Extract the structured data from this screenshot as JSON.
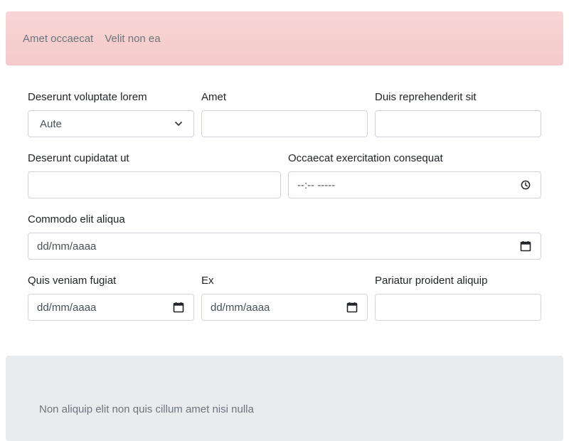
{
  "nav": {
    "links": [
      "Amet occaecat",
      "Velit non ea"
    ]
  },
  "form": {
    "row1": {
      "select": {
        "label": "Deserunt voluptate lorem",
        "value": "Aute"
      },
      "text1": {
        "label": "Amet",
        "value": ""
      },
      "text2": {
        "label": "Duis reprehenderit sit",
        "value": ""
      }
    },
    "row2": {
      "text": {
        "label": "Deserunt cupidatat ut",
        "value": ""
      },
      "time": {
        "label": "Occaecat exercitation consequat",
        "placeholder": "--:-- -----"
      }
    },
    "row3": {
      "date": {
        "label": "Commodo elit aliqua",
        "placeholder": "dd/mm/aaaa"
      }
    },
    "row4": {
      "date1": {
        "label": "Quis veniam fugiat",
        "placeholder": "dd/mm/aaaa"
      },
      "date2": {
        "label": "Ex",
        "placeholder": "dd/mm/aaaa"
      },
      "text": {
        "label": "Pariatur proident aliquip",
        "value": ""
      }
    }
  },
  "footer": {
    "text": "Non aliquip elit non quis cillum amet nisi nulla"
  }
}
